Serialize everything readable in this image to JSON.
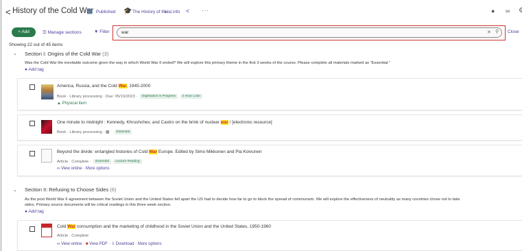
{
  "header": {
    "back_glyph": "<",
    "title": "History of the Cold War",
    "published_label": "Published",
    "course_label": "The History of the ...",
    "listinfo_label": "List info",
    "more_glyph": "···"
  },
  "toolbar": {
    "add_label": "+ Add",
    "manage_label": "Manage sections",
    "filter_label": "Filter",
    "search_value": "war",
    "close_label": "Close"
  },
  "showing": "Showing 22 out of 45 items",
  "sections": [
    {
      "title": "Section I: Origins of the Cold War",
      "count": "(3)",
      "description": "Was the Cold War the inevitable outcome given the way in which World War II ended? We will explore this primary theme in the first 3 weeks of the course. Please complete all materials marked as \"Essential.\"",
      "add_tag": "Add tag"
    },
    {
      "title": "Section II: Refusing to Choose Sides",
      "count": "(6)",
      "description_1": "As the post World War II agreement between the Soviet Union and the United States fell apart the US had to decide how far to go to block the spread of communism. We will explore the effectiveness of neutrality as many countries chose not to take",
      "description_2": "sides. Primary source documents will be critical readings in this three week section.",
      "add_tag": "Add tag"
    }
  ],
  "items": [
    {
      "title_pre": "America, Russia, and the Cold ",
      "title_hl": "War",
      "title_post": ", 1945-2000",
      "meta": "Book · Library processing · Due: 05/19/2023 ·",
      "badges": [
        "Digitisation in Progress",
        "2 Hour Loan"
      ],
      "physical": "Physical item"
    },
    {
      "title_pre": "One minute to midnight : Kennedy, Khrushchev, and Castro on the brink of nuclear ",
      "title_hl": "war",
      "title_post": " / [electronic resource]",
      "meta": "Book · Library processing ·",
      "badges": [
        "Essential"
      ]
    },
    {
      "title_pre": "Beyond the divide: entangled histories of Cold ",
      "title_hl": "War",
      "title_post": " Europe. Edited by Simo Mikkonen and Pia Koivunen",
      "meta": "Article · Complete ·",
      "badges": [
        "Essential",
        "Lecture Reading"
      ],
      "actions": [
        "View online",
        "More options"
      ]
    },
    {
      "title_pre": "Cold ",
      "title_hl": "War",
      "title_post": " consumption and the marketing of childhood in the Soviet Union and the United States, 1950-1960",
      "meta": "Article · Complete",
      "actions": [
        "View online",
        "View PDF",
        "Download",
        "More options"
      ]
    }
  ],
  "colors": {
    "accent": "#4a3f99",
    "green": "#2b7a4b",
    "highlight": "#f7e31c",
    "red": "#d32f2f"
  }
}
